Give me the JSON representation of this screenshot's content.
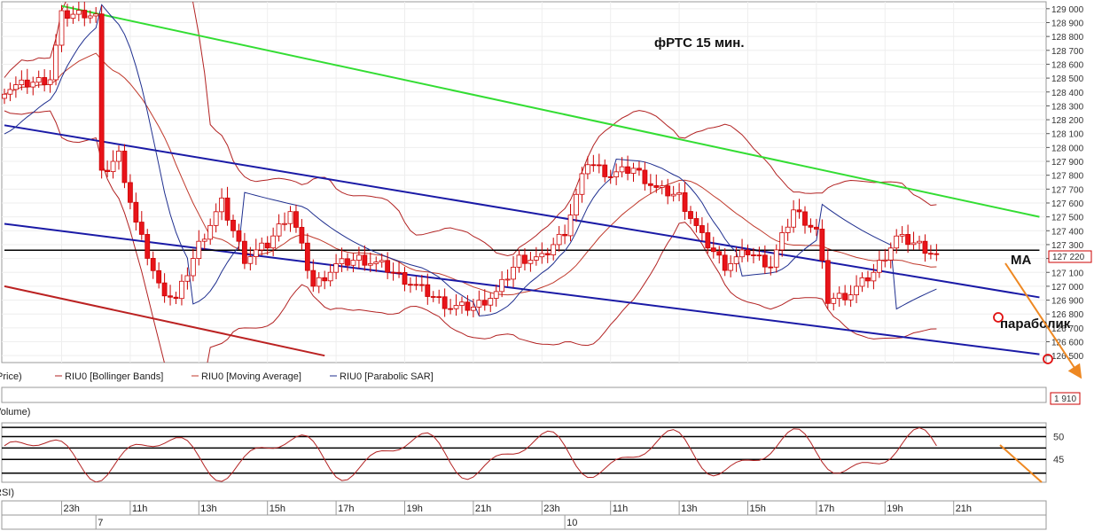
{
  "annotations": {
    "title": "фРТС   15 мин.",
    "ma_label": "MA",
    "parabolic_label": "параболик"
  },
  "legend": {
    "price_label": "Price)",
    "items": [
      {
        "label": "RIU0 [Bollinger Bands]",
        "color": "#b22222"
      },
      {
        "label": "RIU0 [Moving Average]",
        "color": "#c0392b"
      },
      {
        "label": "RIU0 [Parabolic SAR]",
        "color": "#1f2f8f"
      }
    ]
  },
  "volume_panel": {
    "label": "Volume)",
    "value_badge": "1 910"
  },
  "rsi_panel": {
    "label": "RSI)",
    "ticks": [
      "50",
      "45"
    ]
  },
  "price_badge": "127 220",
  "colors": {
    "bull_candle": "#ffffff",
    "bear_candle": "#e8141a",
    "candle_outline": "#cc0000",
    "bollinger": "#b22222",
    "ma": "#c0392b",
    "sar": "#1f2f8f",
    "channel": "#1a1aa6",
    "green_trend": "#33dd33",
    "red_trend": "#bb2222",
    "forecast": "#ee8822"
  },
  "chart_data": {
    "type": "candlestick",
    "title": "фРТС   15 мин.",
    "ylim": [
      126450,
      129050
    ],
    "y_ticks": [
      129000,
      128900,
      128800,
      128700,
      128600,
      128500,
      128400,
      128300,
      128200,
      128100,
      128000,
      127900,
      127800,
      127700,
      127600,
      127500,
      127400,
      127300,
      127200,
      127100,
      127000,
      126900,
      126800,
      126700,
      126600,
      126500
    ],
    "y_tick_labels": [
      "129 000",
      "128 900",
      "128 800",
      "128 700",
      "128 600",
      "128 500",
      "128 400",
      "128 300",
      "128 200",
      "128 100",
      "128 000",
      "127 900",
      "127 800",
      "127 700",
      "127 600",
      "127 500",
      "127 400",
      "127 300",
      "127 200",
      "127 100",
      "127 000",
      "126 900",
      "126 800",
      "126 700",
      "126 600",
      "126 500"
    ],
    "x_time_labels": [
      {
        "bar": 10,
        "label": "23h"
      },
      {
        "bar": 22,
        "label": "11h"
      },
      {
        "bar": 34,
        "label": "13h"
      },
      {
        "bar": 46,
        "label": "15h"
      },
      {
        "bar": 58,
        "label": "17h"
      },
      {
        "bar": 70,
        "label": "19h"
      },
      {
        "bar": 82,
        "label": "21h"
      },
      {
        "bar": 94,
        "label": "23h"
      },
      {
        "bar": 106,
        "label": "11h"
      },
      {
        "bar": 118,
        "label": "13h"
      },
      {
        "bar": 130,
        "label": "15h"
      },
      {
        "bar": 142,
        "label": "17h"
      },
      {
        "bar": 154,
        "label": "19h"
      },
      {
        "bar": 166,
        "label": "21h"
      }
    ],
    "x_date_labels": [
      {
        "bar": 16,
        "label": "7"
      },
      {
        "bar": 98,
        "label": "10"
      }
    ],
    "last_price": 127220,
    "ohlc_key_points": [
      [
        0,
        128420
      ],
      [
        8,
        128500
      ],
      [
        10,
        128950
      ],
      [
        14,
        128970
      ],
      [
        16,
        128950
      ],
      [
        17,
        127800
      ],
      [
        20,
        127950
      ],
      [
        23,
        127450
      ],
      [
        27,
        127000
      ],
      [
        30,
        126900
      ],
      [
        34,
        127300
      ],
      [
        38,
        127600
      ],
      [
        42,
        127200
      ],
      [
        46,
        127300
      ],
      [
        50,
        127550
      ],
      [
        54,
        127000
      ],
      [
        58,
        127150
      ],
      [
        62,
        127200
      ],
      [
        66,
        127150
      ],
      [
        70,
        127050
      ],
      [
        74,
        126950
      ],
      [
        78,
        126850
      ],
      [
        82,
        126850
      ],
      [
        86,
        126950
      ],
      [
        90,
        127200
      ],
      [
        94,
        127200
      ],
      [
        98,
        127400
      ],
      [
        102,
        127900
      ],
      [
        106,
        127800
      ],
      [
        110,
        127850
      ],
      [
        114,
        127700
      ],
      [
        118,
        127650
      ],
      [
        122,
        127350
      ],
      [
        126,
        127150
      ],
      [
        130,
        127250
      ],
      [
        134,
        127150
      ],
      [
        138,
        127550
      ],
      [
        142,
        127400
      ],
      [
        144,
        126900
      ],
      [
        148,
        126950
      ],
      [
        152,
        127100
      ],
      [
        156,
        127350
      ],
      [
        160,
        127300
      ],
      [
        163,
        127220
      ]
    ],
    "trend_lines": [
      {
        "name": "green",
        "points": [
          [
            10,
            129020
          ],
          [
            181,
            127500
          ]
        ]
      },
      {
        "name": "channel-upper",
        "points": [
          [
            0,
            128160
          ],
          [
            181,
            126920
          ]
        ]
      },
      {
        "name": "channel-lower",
        "points": [
          [
            0,
            127450
          ],
          [
            181,
            126510
          ]
        ]
      },
      {
        "name": "red",
        "points": [
          [
            0,
            127000
          ],
          [
            56,
            126500
          ]
        ]
      },
      {
        "name": "horizontal",
        "points": [
          [
            0,
            127260
          ],
          [
            181,
            127260
          ]
        ]
      }
    ],
    "rsi": {
      "ylim": [
        40,
        53
      ],
      "levels": [
        52,
        50,
        47.5,
        45,
        42
      ]
    },
    "n_bars": 182
  }
}
